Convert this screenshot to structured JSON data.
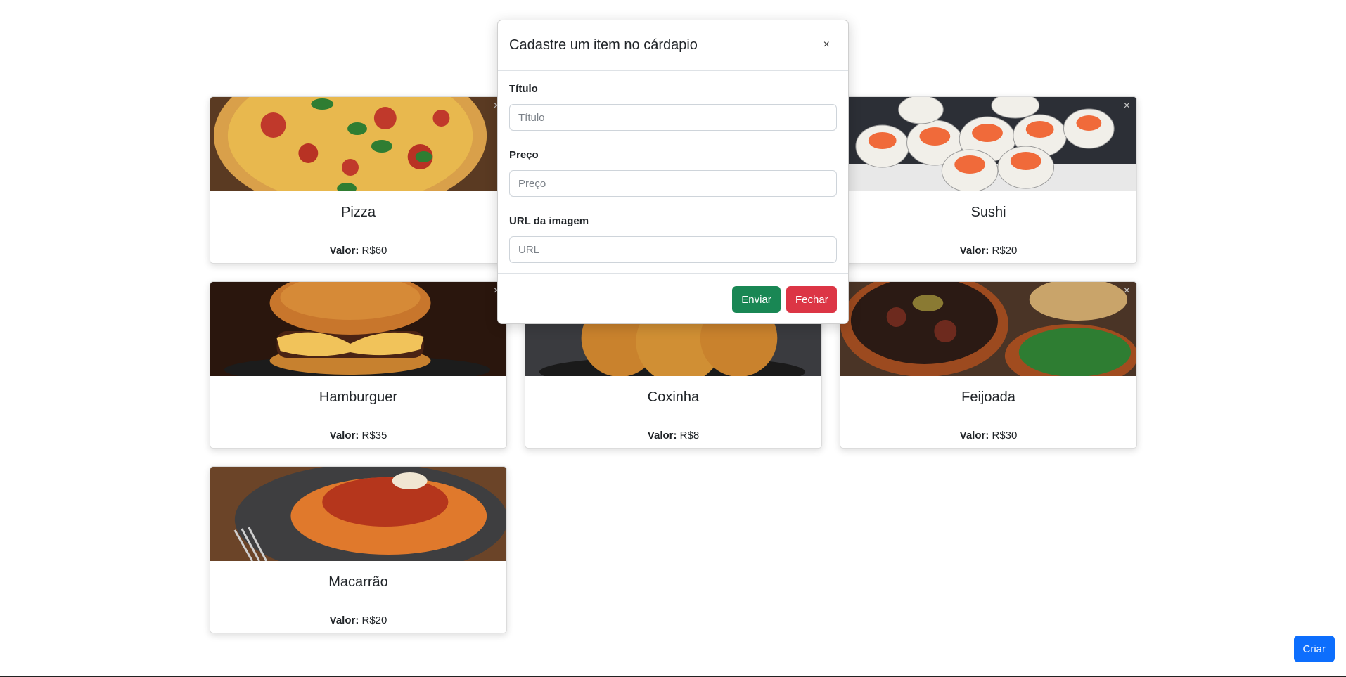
{
  "modal": {
    "title": "Cadastre um item no cárdapio",
    "close_icon": "×",
    "fields": [
      {
        "label": "Título",
        "placeholder": "Título",
        "value": ""
      },
      {
        "label": "Preço",
        "placeholder": "Preço",
        "value": ""
      },
      {
        "label": "URL da imagem",
        "placeholder": "URL",
        "value": ""
      }
    ],
    "submit_label": "Enviar",
    "cancel_label": "Fechar"
  },
  "cards": [
    {
      "title": "Pizza",
      "price_label": "Valor:",
      "price": "R$60",
      "close": "×",
      "image": "pizza"
    },
    {
      "title": "",
      "price_label": "",
      "price": "",
      "close": "",
      "image": "hidden"
    },
    {
      "title": "Sushi",
      "price_label": "Valor:",
      "price": "R$20",
      "close": "×",
      "image": "sushi"
    },
    {
      "title": "Hamburguer",
      "price_label": "Valor:",
      "price": "R$35",
      "close": "×",
      "image": "burger"
    },
    {
      "title": "Coxinha",
      "price_label": "Valor:",
      "price": "R$8",
      "close": "",
      "image": "coxinha"
    },
    {
      "title": "Feijoada",
      "price_label": "Valor:",
      "price": "R$30",
      "close": "×",
      "image": "feijoada"
    },
    {
      "title": "Macarrão",
      "price_label": "Valor:",
      "price": "R$20",
      "close": "",
      "image": "macarrao"
    }
  ],
  "create_button": "Criar",
  "colors": {
    "primary": "#0d6efd",
    "success": "#198754",
    "danger": "#dc3545"
  }
}
